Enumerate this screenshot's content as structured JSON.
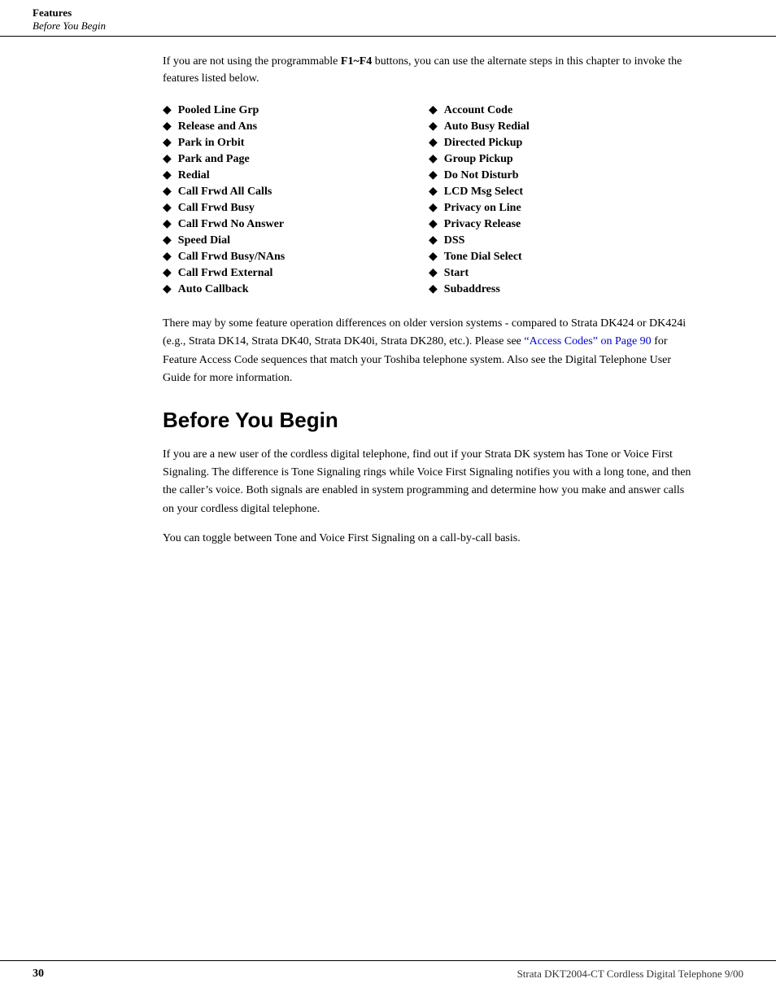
{
  "header": {
    "section_label": "Features",
    "subsection_label": "Before You Begin"
  },
  "intro": {
    "paragraph": "If you are not using the programmable F1~F4 buttons, you can use the alternate steps in this chapter to invoke the features listed below."
  },
  "features": {
    "left_column": [
      "Pooled Line Grp",
      "Release and Ans",
      "Park in Orbit",
      "Park and Page",
      "Redial",
      "Call Frwd All Calls",
      "Call Frwd Busy",
      "Call Frwd No Answer",
      "Speed Dial",
      "Call Frwd Busy/NAns",
      "Call Frwd External",
      "Auto Callback"
    ],
    "right_column": [
      "Account Code",
      "Auto Busy Redial",
      "Directed Pickup",
      "Group Pickup",
      "Do Not Disturb",
      "LCD Msg Select",
      "Privacy on Line",
      "Privacy Release",
      "DSS",
      "Tone Dial Select",
      "Start",
      "Subaddress"
    ]
  },
  "description": {
    "paragraph1": "There may by some feature operation differences on older version systems - compared to Strata DK424 or DK424i (e.g., Strata DK14, Strata DK40, Strata DK40i, Strata DK280, etc.). Please see “Access Codes” on Page 90 for Feature Access Code sequences that match your Toshiba telephone system. Also see the Digital Telephone User Guide for more information.",
    "link_text": "“Access Codes” on Page 90"
  },
  "section": {
    "heading": "Before You Begin",
    "paragraph1": "If you are a new user of the cordless digital telephone, find out if your Strata DK system has Tone or Voice First Signaling. The difference is Tone Signaling rings while Voice First Signaling notifies you with a long tone, and then the caller’s voice. Both signals are enabled in system programming and determine how you make and answer calls on your cordless digital telephone.",
    "paragraph2": "You can toggle between Tone and Voice First Signaling on a call-by-call basis."
  },
  "footer": {
    "page_number": "30",
    "document_title": "Strata DKT2004-CT Cordless Digital Telephone   9/00"
  },
  "bold_codes": {
    "f1f4": "F1~F4"
  }
}
